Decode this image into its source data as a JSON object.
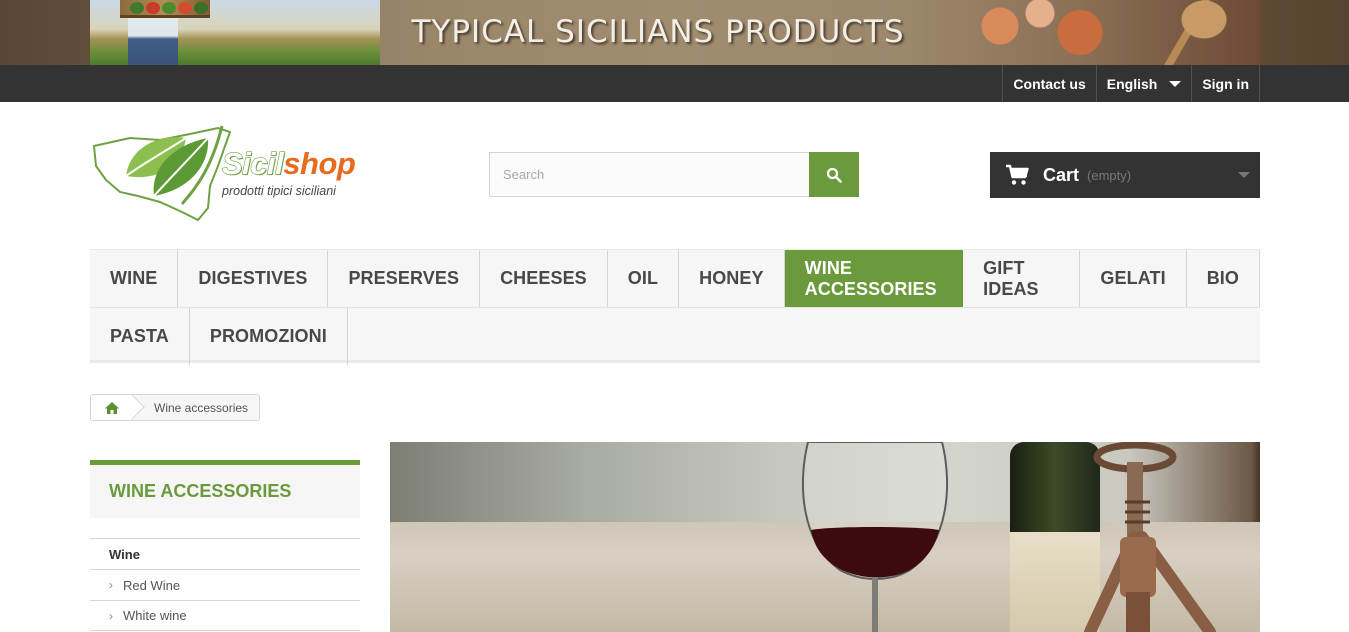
{
  "banner": {
    "title": "TYPICAL SICILIANS PRODUCTS"
  },
  "topnav": {
    "contact": "Contact us",
    "language": "English",
    "signin": "Sign in"
  },
  "logo": {
    "brand_left": "Sicil",
    "brand_right": "shop",
    "tagline": "prodotti tipici siciliani"
  },
  "search": {
    "placeholder": "Search",
    "icon": "search-icon"
  },
  "cart": {
    "title": "Cart",
    "status": "(empty)",
    "icon": "cart-icon"
  },
  "menu": {
    "row1": [
      "WINE",
      "DIGESTIVES",
      "PRESERVES",
      "CHEESES",
      "OIL",
      "HONEY",
      "WINE ACCESSORIES",
      "GIFT IDEAS",
      "GELATI",
      "BIO"
    ],
    "row2": [
      "PASTA",
      "PROMOZIONI"
    ],
    "active": "WINE ACCESSORIES"
  },
  "breadcrumb": {
    "home_icon": "home-icon",
    "current": "Wine accessories"
  },
  "sidebar": {
    "title": "WINE ACCESSORIES",
    "items": [
      {
        "label": "Wine",
        "level": "parent"
      },
      {
        "label": "Red Wine",
        "level": "child"
      },
      {
        "label": "White wine",
        "level": "child"
      }
    ]
  },
  "colors": {
    "accent": "#6a9a3c",
    "dark": "#333333",
    "orange": "#e86a1f"
  }
}
